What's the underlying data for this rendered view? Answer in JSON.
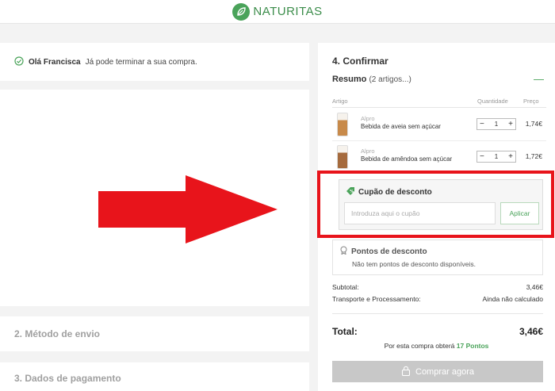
{
  "brand": {
    "name": "NATURITAS",
    "accent": "#4aa35a"
  },
  "greeting": {
    "name": "Olá Francisca",
    "message": "Já pode terminar a sua compra."
  },
  "steps": {
    "shipping": "2. Método de envio",
    "payment": "3. Dados de pagamento",
    "confirm": "4. Confirmar"
  },
  "summary": {
    "title": "Resumo",
    "count": "(2 artigos...)",
    "columns": {
      "item": "Artigo",
      "qty": "Quantidade",
      "price": "Preço"
    },
    "items": [
      {
        "brand": "Alpro",
        "name": "Bebida de aveia sem açúcar",
        "qty": "1",
        "price": "1,74€"
      },
      {
        "brand": "Alpro",
        "name": "Bebida de amêndoa sem açúcar",
        "qty": "1",
        "price": "1,72€"
      }
    ],
    "stepper": {
      "minus": "−",
      "plus": "+"
    }
  },
  "coupon": {
    "title": "Cupão de desconto",
    "placeholder": "Introduza aqui o cupão",
    "apply": "Aplicar"
  },
  "points": {
    "title": "Pontos de desconto",
    "message": "Não tem pontos de desconto disponíveis."
  },
  "totals": {
    "subtotal_label": "Subtotal:",
    "subtotal": "3,46€",
    "shipping_label": "Transporte e Processamento:",
    "shipping": "Ainda não calculado",
    "total_label": "Total:",
    "total": "3,46€",
    "earn_prefix": "Por esta compra obterá",
    "earn_points": "17 Pontos"
  },
  "buy_button": "Comprar agora",
  "colors": {
    "highlight": "#e8141b",
    "arrow": "#e8141b"
  }
}
